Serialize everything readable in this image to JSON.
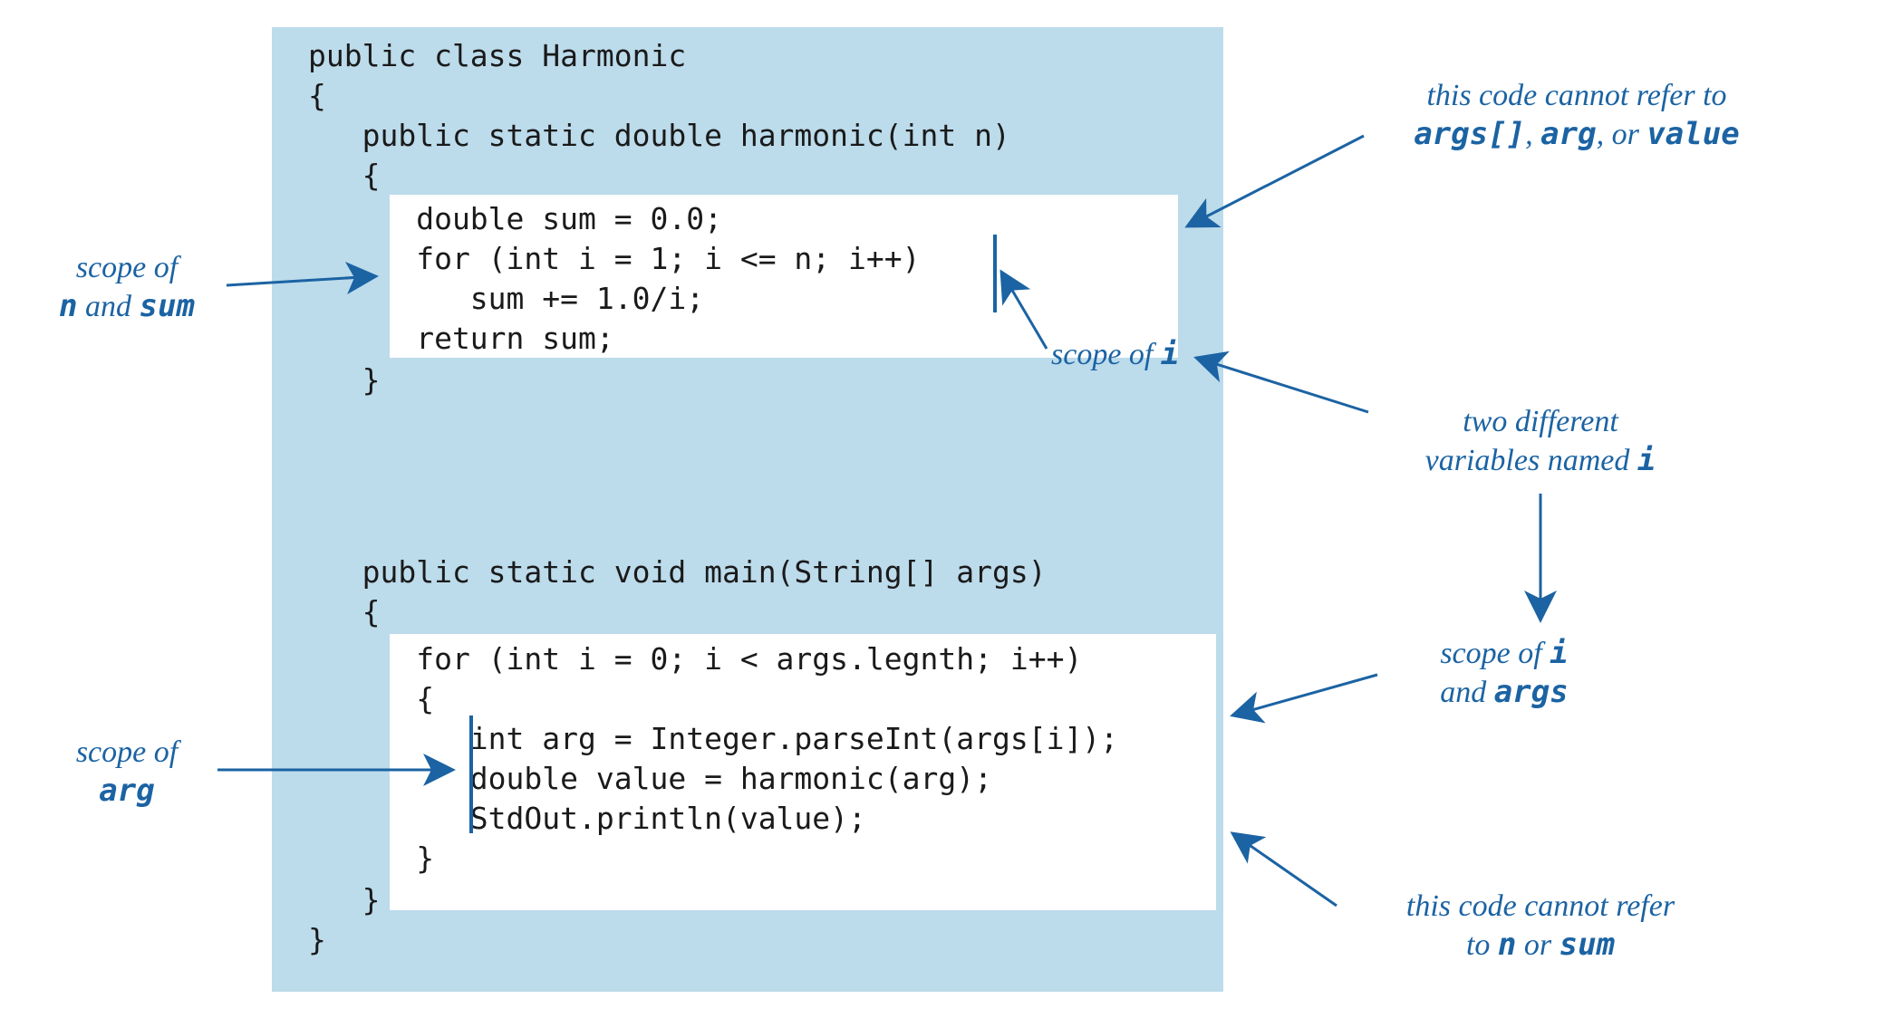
{
  "code": {
    "class_decl": "public class Harmonic",
    "brace_open": "{",
    "harmonic_sig": "   public static double harmonic(int n)",
    "harmonic_open": "   {",
    "h_l1": "      double sum = 0.0;",
    "h_l2": "      for (int i = 1; i <= n; i++)",
    "h_l3": "         sum += 1.0/i;",
    "h_l4": "      return sum;",
    "harmonic_close": "   }",
    "main_sig": "   public static void main(String[] args)",
    "main_open": "   {",
    "m_l1": "      for (int i = 0; i < args.legnth; i++)",
    "m_l2": "      {",
    "m_l3": "         int arg = Integer.parseInt(args[i]);",
    "m_l4": "         double value = harmonic(arg);",
    "m_l5": "         StdOut.println(value);",
    "m_l6": "      }",
    "main_close": "   }",
    "brace_close": "}"
  },
  "annotations": {
    "scope_n_sum_l1": "scope of",
    "scope_n_sum_l2_a": "n",
    "scope_n_sum_l2_b": " and ",
    "scope_n_sum_l2_c": "sum",
    "scope_arg_l1": "scope of",
    "scope_arg_l2": "arg",
    "cannot_args_l1": "this code cannot refer to",
    "cannot_args_l2_a": "args[]",
    "cannot_args_l2_b": ", ",
    "cannot_args_l2_c": "arg",
    "cannot_args_l2_d": ", or ",
    "cannot_args_l2_e": "value",
    "scope_i_a": "scope of ",
    "scope_i_b": "i",
    "two_i_l1": "two different",
    "two_i_l2_a": "variables named ",
    "two_i_l2_b": "i",
    "scope_i_args_l1_a": "scope of ",
    "scope_i_args_l1_b": "i",
    "scope_i_args_l2_a": "and ",
    "scope_i_args_l2_b": "args",
    "cannot_n_sum_l1": "this code cannot refer",
    "cannot_n_sum_l2_a": "to ",
    "cannot_n_sum_l2_b": "n",
    "cannot_n_sum_l2_c": " or ",
    "cannot_n_sum_l2_d": "sum"
  }
}
